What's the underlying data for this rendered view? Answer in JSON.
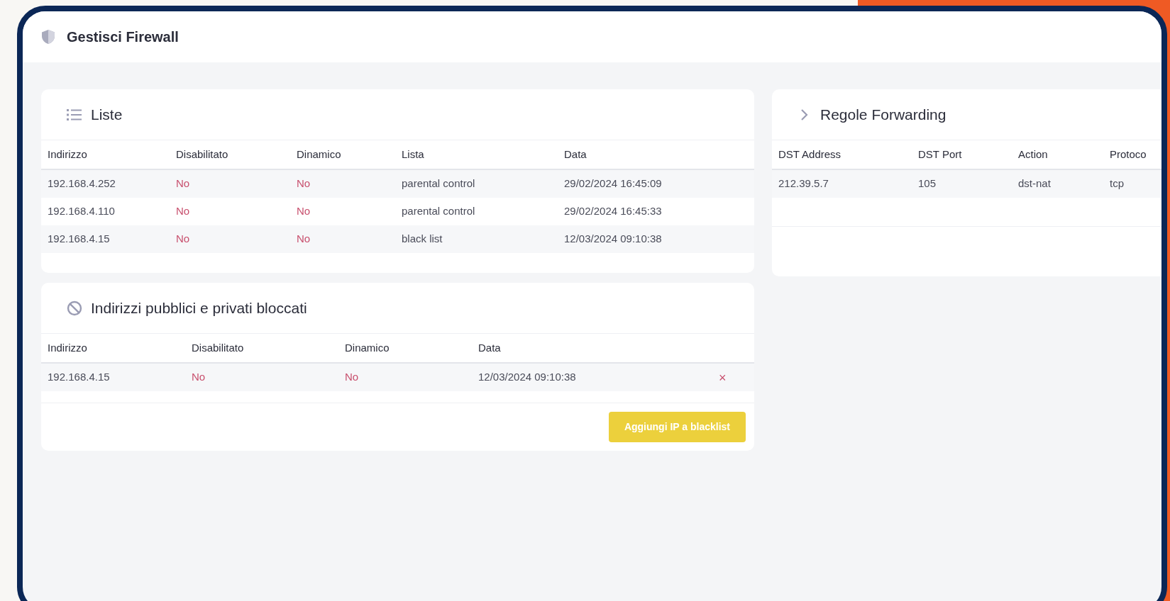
{
  "window": {
    "title": "Gestisci Firewall"
  },
  "liste": {
    "title": "Liste",
    "columns": [
      {
        "label": "Indirizzo",
        "kind": "text"
      },
      {
        "label": "Disabilitato",
        "kind": "flag"
      },
      {
        "label": "Dinamico",
        "kind": "flag"
      },
      {
        "label": "Lista",
        "kind": "text"
      },
      {
        "label": "Data",
        "kind": "text"
      }
    ],
    "rows": [
      [
        "192.168.4.252",
        "No",
        "No",
        "parental control",
        "29/02/2024 16:45:09"
      ],
      [
        "192.168.4.110",
        "No",
        "No",
        "parental control",
        "29/02/2024 16:45:33"
      ],
      [
        "192.168.4.15",
        "No",
        "No",
        "black list",
        "12/03/2024 09:10:38"
      ]
    ]
  },
  "blocked": {
    "title": "Indirizzi pubblici e privati bloccati",
    "columns": [
      {
        "label": "Indirizzo",
        "kind": "text"
      },
      {
        "label": "Disabilitato",
        "kind": "flag"
      },
      {
        "label": "Dinamico",
        "kind": "flag"
      },
      {
        "label": "Data",
        "kind": "text"
      }
    ],
    "rows": [
      [
        "192.168.4.15",
        "No",
        "No",
        "12/03/2024 09:10:38"
      ]
    ],
    "remove_icon": "×",
    "add_button": "Aggiungi IP a blacklist"
  },
  "forwarding": {
    "title": "Regole Forwarding",
    "columns": [
      "DST Address",
      "DST Port",
      "Action",
      "Protoco"
    ],
    "rows": [
      [
        "212.39.5.7",
        "105",
        "dst-nat",
        "tcp"
      ]
    ]
  }
}
